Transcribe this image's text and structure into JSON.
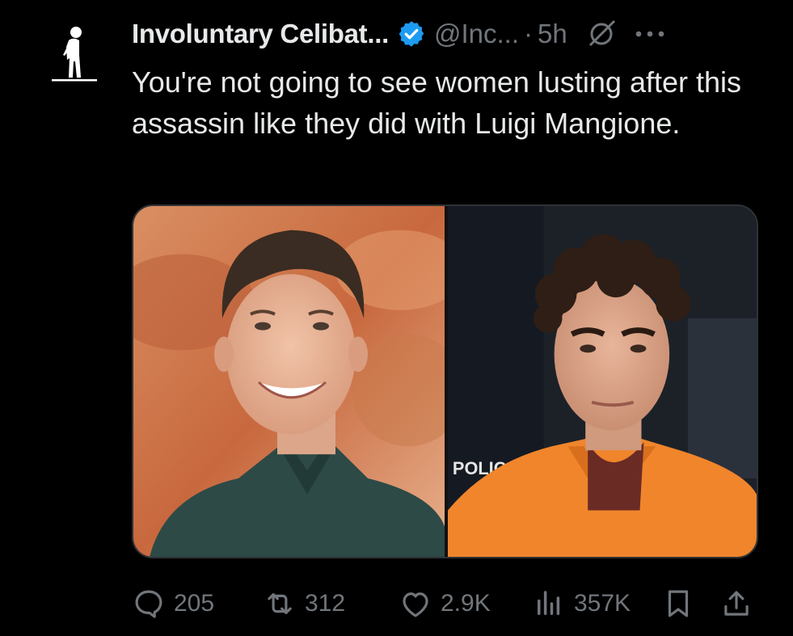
{
  "tweet": {
    "display_name": "Involuntary Celibat...",
    "handle": "@Inc...",
    "separator": "·",
    "time": "5h",
    "text": "You're not going to see women lusting after this assassin like they did with Luigi Mangione.",
    "verified_color": "#1d9bf0",
    "icons": [
      "incel-avatar-icon",
      "verified-badge-icon",
      "grok-icon",
      "more-icon"
    ]
  },
  "media": {
    "images": [
      "left-photo-smiling-man-green-shirt",
      "right-photo-man-orange-jumpsuit"
    ],
    "police_text": "POLIC"
  },
  "actions": {
    "replies": "205",
    "reposts": "312",
    "likes": "2.9K",
    "views": "357K",
    "icons": [
      "reply-icon",
      "repost-icon",
      "like-icon",
      "views-icon",
      "bookmark-icon",
      "share-icon"
    ]
  }
}
